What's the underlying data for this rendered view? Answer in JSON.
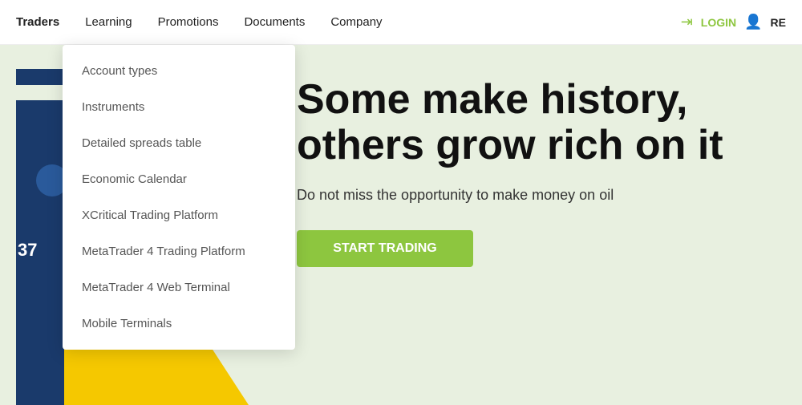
{
  "nav": {
    "items": [
      {
        "label": "Traders",
        "id": "traders",
        "active": true
      },
      {
        "label": "Learning",
        "id": "learning",
        "active": false
      },
      {
        "label": "Promotions",
        "id": "promotions",
        "active": false
      },
      {
        "label": "Documents",
        "id": "documents",
        "active": false
      },
      {
        "label": "Company",
        "id": "company",
        "active": false
      }
    ],
    "login": "LOGIN",
    "register": "RE"
  },
  "dropdown": {
    "items": [
      {
        "label": "Account types",
        "id": "account-types"
      },
      {
        "label": "Instruments",
        "id": "instruments"
      },
      {
        "label": "Detailed spreads table",
        "id": "detailed-spreads"
      },
      {
        "label": "Economic Calendar",
        "id": "economic-calendar"
      },
      {
        "label": "XCritical Trading Platform",
        "id": "xcritical"
      },
      {
        "label": "MetaTrader 4 Trading Platform",
        "id": "mt4-trading"
      },
      {
        "label": "MetaTrader 4 Web Terminal",
        "id": "mt4-web"
      },
      {
        "label": "Mobile Terminals",
        "id": "mobile"
      }
    ]
  },
  "hero": {
    "title": "Some make history, others grow rich on it",
    "subtitle": "Do not miss the opportunity to\nmake money on oil",
    "cta": "START TRADING"
  }
}
